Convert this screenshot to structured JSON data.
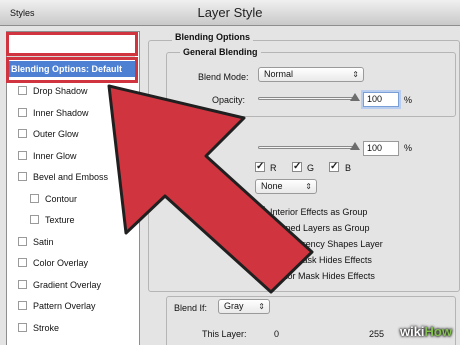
{
  "window": {
    "title": "Layer Style"
  },
  "styles_panel": {
    "header": "Styles",
    "selected": "Blending Options: Default",
    "items": [
      "Drop Shadow",
      "Inner Shadow",
      "Outer Glow",
      "Inner Glow",
      "Bevel and Emboss",
      "Contour",
      "Texture",
      "Satin",
      "Color Overlay",
      "Gradient Overlay",
      "Pattern Overlay",
      "Stroke"
    ]
  },
  "blending": {
    "section_title": "Blending Options",
    "general_title": "General Blending",
    "blend_mode_label": "Blend Mode:",
    "blend_mode_value": "Normal",
    "opacity_label": "Opacity:",
    "opacity_value": "100",
    "opacity_unit": "%",
    "fill_value": "100",
    "fill_unit": "%",
    "channels": [
      {
        "label": "R",
        "checked": true
      },
      {
        "label": "G",
        "checked": true
      },
      {
        "label": "B",
        "checked": true
      }
    ],
    "knockout_value": "None",
    "options": [
      {
        "label": "Interior Effects as Group",
        "checked": false
      },
      {
        "label": "Clipped Layers as Group",
        "checked": true
      },
      {
        "label": "Transparency Shapes Layer",
        "checked": true
      },
      {
        "label": "Layer Mask Hides Effects",
        "checked": false
      },
      {
        "label": "Vector Mask Hides Effects",
        "checked": false
      }
    ],
    "blend_if_label": "Blend If:",
    "blend_if_value": "Gray",
    "this_layer_label": "This Layer:",
    "this_layer_min": "0",
    "this_layer_max": "255"
  },
  "colors": {
    "highlight": "#4d7fd3",
    "arrow": "#d0343f"
  },
  "watermark": {
    "prefix": "wiki",
    "suffix": "How"
  }
}
